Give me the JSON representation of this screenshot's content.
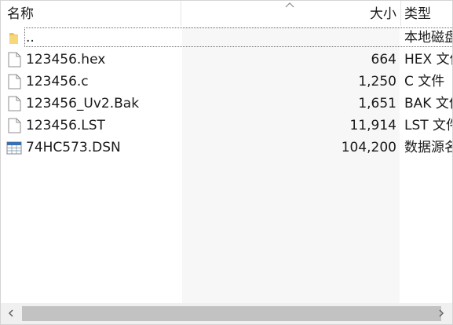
{
  "columns": {
    "name": "名称",
    "size": "大小",
    "type": "类型"
  },
  "files": [
    {
      "name": "..",
      "size": "",
      "type": "本地磁盘",
      "icon": "folder-icon"
    },
    {
      "name": "123456.hex",
      "size": "664",
      "type": "HEX 文件",
      "icon": "file-icon"
    },
    {
      "name": "123456.c",
      "size": "1,250",
      "type": "C 文件",
      "icon": "file-icon"
    },
    {
      "name": "123456_Uv2.Bak",
      "size": "1,651",
      "type": "BAK 文件",
      "icon": "file-icon"
    },
    {
      "name": "123456.LST",
      "size": "11,914",
      "type": "LST 文件",
      "icon": "file-icon"
    },
    {
      "name": "74HC573.DSN",
      "size": "104,200",
      "type": "数据源名称",
      "icon": "database-file-icon"
    }
  ],
  "sort": {
    "column": "size",
    "direction": "ascending"
  },
  "colors": {
    "border": "#d4d4d4",
    "sorted_column_bg": "#f7f7f7",
    "scrollbar_thumb": "#c2c2c2",
    "folder": "#f0c34f"
  }
}
